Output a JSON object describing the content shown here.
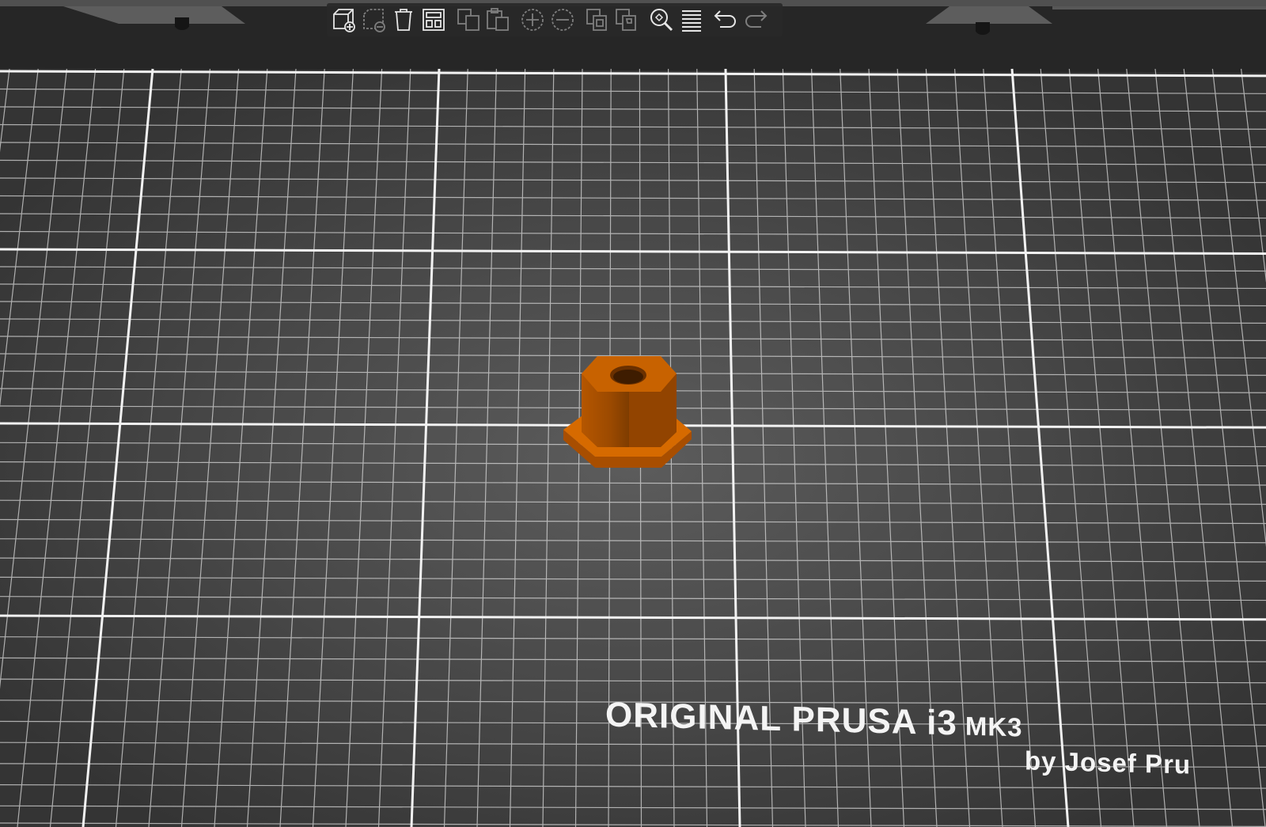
{
  "viewport": {
    "bed_label": {
      "title": "ORIGINAL PRUSA i3",
      "model": "MK3",
      "subtitle": "by Josef Pru"
    },
    "object": {
      "name": "hex-nut-model",
      "color": "#cc6400"
    },
    "colors": {
      "bed": "#3c3c3c",
      "bed_center": "#5a5a5a",
      "grid_line": "#e8e8e8",
      "frame": "#262626",
      "toolbar_bg": "#282828",
      "icon": "#e6e6e6"
    }
  },
  "toolbar": {
    "buttons": [
      {
        "icon": "add-icon",
        "enabled": true
      },
      {
        "icon": "delete-icon",
        "enabled": false
      },
      {
        "icon": "delete-all-icon",
        "enabled": true
      },
      {
        "icon": "arrange-icon",
        "enabled": true
      },
      {
        "icon": "copy-icon",
        "enabled": false
      },
      {
        "icon": "paste-icon",
        "enabled": false
      },
      {
        "icon": "add-instance-icon",
        "enabled": false
      },
      {
        "icon": "remove-instance-icon",
        "enabled": false
      },
      {
        "icon": "split-objects-icon",
        "enabled": false
      },
      {
        "icon": "split-parts-icon",
        "enabled": false
      },
      {
        "icon": "search-icon",
        "enabled": true
      },
      {
        "icon": "layers-editing-icon",
        "enabled": true
      },
      {
        "icon": "undo-icon",
        "enabled": true
      },
      {
        "icon": "redo-icon",
        "enabled": false
      }
    ]
  }
}
